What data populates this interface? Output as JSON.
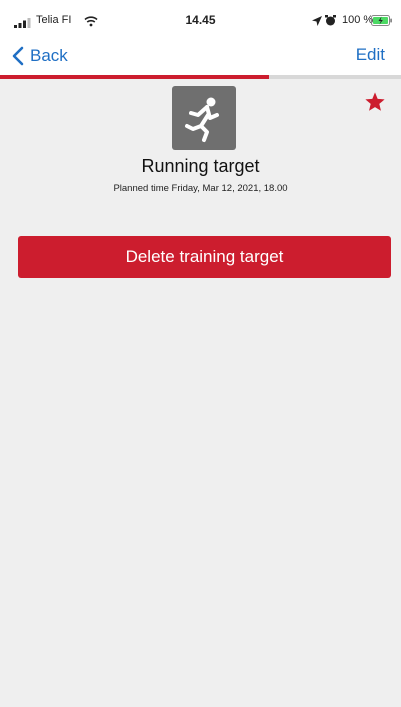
{
  "status_bar": {
    "carrier": "Telia FI",
    "time": "14.45",
    "battery": "100 %",
    "icons": [
      "signal-bars-icon",
      "wifi-icon",
      "location-arrow-icon",
      "alarm-icon",
      "battery-charging-icon"
    ]
  },
  "nav": {
    "back_label": "Back",
    "edit_label": "Edit",
    "progress_fraction": 0.67
  },
  "target": {
    "icon": "running-person-icon",
    "title": "Running target",
    "planned_time": "Planned time Friday, Mar 12, 2021, 18.00",
    "favorite_icon": "star-icon"
  },
  "actions": {
    "delete_label": "Delete training target"
  },
  "colors": {
    "accent_red": "#cc1d2e",
    "link_blue": "#1f6fc4",
    "background": "#efefef",
    "icon_bg": "#6f6f6f"
  }
}
